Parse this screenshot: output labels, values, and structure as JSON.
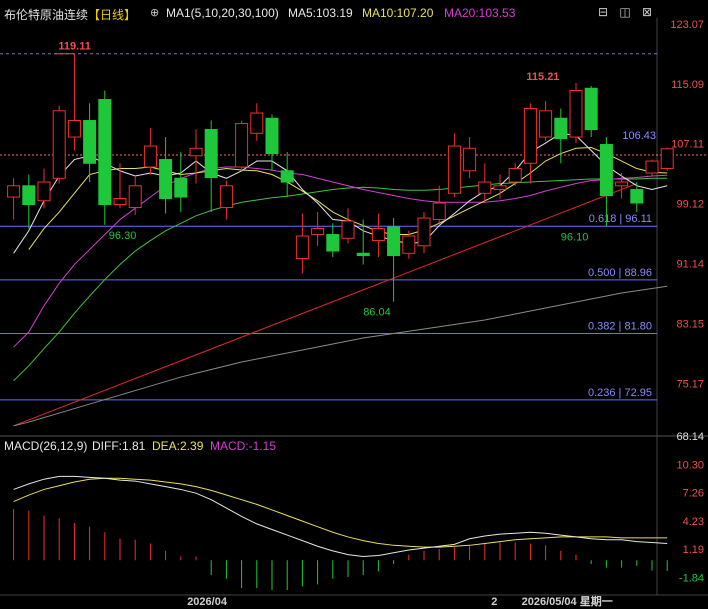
{
  "instrument": {
    "name": "布伦特原油连续",
    "period": "【日线】"
  },
  "indicators": {
    "ma_label": "MA1(5,10,20,30,100)",
    "ma5": "MA5:103.19",
    "ma10": "MA10:107.20",
    "ma20": "MA20:103.53",
    "macd_label": "MACD(26,12,9)",
    "diff": "DIFF:1.81",
    "dea": "DEA:2.39",
    "macd": "MACD:-1.15"
  },
  "toolbar": {
    "icons": [
      "settings-icon",
      "remove-icon",
      "restore-icon",
      "close-icon"
    ]
  },
  "colors": {
    "up": "#ef2f2f",
    "down": "#1fc73a",
    "ma5": "#e6e6e6",
    "ma10": "#e8e05a",
    "ma20": "#d23fd2",
    "ma30": "#3fc43f",
    "ma100": "#8a8a8a",
    "fib": "#6c6cff",
    "trend": "#e02828"
  },
  "chart_data": {
    "type": "candlestick",
    "y_axis_ticks": [
      "123.07",
      "115.09",
      "107.11",
      "99.12",
      "91.14",
      "83.15",
      "75.17",
      "68.14"
    ],
    "y_range": [
      68.14,
      123.07
    ],
    "current_price": "106.43",
    "last_close_line": 105.6,
    "high_marker": {
      "label": "119.11",
      "value": 119.11,
      "bar": 4
    },
    "high_marker2": {
      "label": "115.21",
      "value": 115.21,
      "bar": 34
    },
    "low_markers": [
      {
        "label": "96.30",
        "value": 96.3,
        "bar": 6
      },
      {
        "label": "86.04",
        "value": 86.04,
        "bar": 23
      },
      {
        "label": "96.10",
        "value": 96.1,
        "bar": 36
      }
    ],
    "fib_levels": [
      {
        "label": "0.618 | 96.11",
        "value": 96.11
      },
      {
        "label": "0.500 | 88.96",
        "value": 88.96
      },
      {
        "label": "0.382 | 81.80",
        "value": 81.8
      },
      {
        "label": "0.236 | 72.95",
        "value": 72.95
      }
    ],
    "top_ref": 119.11,
    "trendline": {
      "from": [
        0,
        69.5
      ],
      "to": [
        41,
        101.8
      ]
    },
    "candles": [
      [
        100.0,
        101.5,
        97.0,
        102.5
      ],
      [
        101.5,
        99.0,
        95.8,
        103.0
      ],
      [
        99.5,
        102.0,
        98.5,
        103.8
      ],
      [
        102.5,
        111.5,
        101.8,
        112.2
      ],
      [
        108.0,
        110.2,
        106.2,
        119.11
      ],
      [
        110.2,
        104.5,
        102.0,
        112.5
      ],
      [
        113.0,
        99.0,
        96.3,
        114.2
      ],
      [
        99.0,
        99.8,
        98.5,
        104.5
      ],
      [
        98.6,
        101.5,
        97.6,
        102.8
      ],
      [
        104.0,
        106.8,
        103.0,
        109.2
      ],
      [
        105.0,
        99.8,
        97.8,
        108.0
      ],
      [
        102.5,
        100.0,
        98.0,
        106.0
      ],
      [
        105.5,
        106.5,
        101.8,
        109.0
      ],
      [
        109.0,
        102.6,
        98.0,
        110.2
      ],
      [
        98.6,
        101.5,
        97.0,
        102.2
      ],
      [
        104.0,
        109.8,
        103.5,
        110.2
      ],
      [
        108.5,
        111.2,
        107.5,
        112.5
      ],
      [
        110.5,
        105.8,
        103.5,
        111.0
      ],
      [
        103.5,
        102.0,
        100.0,
        106.0
      ],
      [
        91.8,
        94.8,
        89.8,
        97.8
      ],
      [
        95.0,
        95.8,
        93.5,
        98.0
      ],
      [
        95.0,
        92.8,
        92.0,
        96.5
      ],
      [
        94.5,
        96.8,
        93.8,
        98.5
      ],
      [
        92.5,
        92.2,
        91.0,
        97.0
      ],
      [
        94.2,
        95.8,
        92.0,
        97.8
      ],
      [
        96.0,
        92.2,
        86.04,
        97.2
      ],
      [
        92.5,
        94.8,
        91.8,
        95.5
      ],
      [
        93.5,
        97.2,
        92.5,
        98.0
      ],
      [
        97.0,
        99.2,
        96.5,
        101.5
      ],
      [
        100.5,
        106.8,
        100.0,
        108.5
      ],
      [
        103.5,
        106.5,
        102.5,
        108.0
      ],
      [
        100.5,
        102.0,
        99.5,
        104.5
      ],
      [
        101.0,
        101.5,
        99.8,
        103.0
      ],
      [
        102.0,
        103.8,
        101.5,
        104.5
      ],
      [
        104.5,
        111.8,
        101.8,
        112.5
      ],
      [
        108.0,
        111.5,
        107.5,
        112.8
      ],
      [
        110.5,
        107.8,
        104.5,
        111.8
      ],
      [
        108.0,
        114.2,
        107.2,
        115.21
      ],
      [
        114.5,
        109.0,
        108.0,
        114.8
      ],
      [
        107.0,
        100.2,
        96.1,
        108.0
      ],
      [
        101.5,
        102.0,
        99.8,
        103.2
      ],
      [
        101.0,
        99.2,
        98.0,
        102.0
      ],
      [
        103.2,
        104.8,
        102.8,
        105.0
      ],
      [
        103.8,
        106.43,
        103.5,
        106.6
      ]
    ],
    "ma_series": {
      "ma5": [
        92.5,
        95.5,
        99.5,
        102.8,
        105.0,
        105.5,
        104.5,
        103.5,
        102.8,
        103.2,
        102.8,
        103.2,
        104.8,
        103.2,
        102.5,
        103.5,
        104.8,
        104.8,
        103.5,
        101.0,
        99.2,
        97.0,
        96.8,
        95.5,
        94.8,
        94.2,
        93.8,
        94.0,
        96.2,
        97.8,
        99.5,
        100.8,
        101.5,
        103.5,
        106.0,
        107.2,
        108.5,
        108.2,
        106.2,
        104.2,
        102.8,
        101.5,
        101.0,
        101.5
      ],
      "ma10": [
        null,
        93.0,
        95.8,
        98.0,
        100.5,
        103.0,
        103.5,
        103.8,
        103.8,
        104.0,
        103.5,
        103.0,
        103.2,
        103.5,
        103.8,
        103.6,
        103.5,
        103.0,
        102.0,
        100.8,
        99.5,
        98.0,
        97.0,
        96.2,
        95.4,
        95.0,
        95.0,
        95.6,
        96.5,
        97.5,
        98.5,
        99.5,
        100.5,
        101.8,
        103.2,
        104.8,
        105.8,
        106.5,
        106.6,
        105.8,
        104.8,
        103.8,
        103.3,
        103.2
      ],
      "ma20": [
        80.0,
        82.0,
        85.5,
        88.5,
        91.0,
        93.0,
        95.0,
        97.0,
        98.5,
        100.0,
        101.5,
        102.5,
        103.2,
        103.8,
        104.0,
        104.0,
        103.8,
        103.6,
        103.2,
        103.0,
        102.5,
        102.0,
        101.5,
        101.0,
        100.6,
        100.2,
        99.8,
        99.5,
        99.3,
        99.3,
        99.3,
        99.3,
        99.5,
        99.8,
        100.2,
        100.8,
        101.3,
        101.8,
        102.2,
        102.3,
        102.5,
        102.6,
        102.8,
        102.9
      ],
      "ma30": [
        75.5,
        77.5,
        79.8,
        82.0,
        84.5,
        86.8,
        89.0,
        91.0,
        92.8,
        94.2,
        95.5,
        96.5,
        97.5,
        98.2,
        98.8,
        99.3,
        99.6,
        99.9,
        100.1,
        100.4,
        100.7,
        101.0,
        101.2,
        101.3,
        101.2,
        101.0,
        100.9,
        100.9,
        101.0,
        101.2,
        101.4,
        101.6,
        101.8,
        101.9,
        102.0,
        102.1,
        102.2,
        102.3,
        102.4,
        102.4,
        102.4,
        102.4,
        102.5,
        102.5
      ],
      "ma100": [
        69.5,
        70.0,
        70.6,
        71.2,
        71.8,
        72.4,
        73.0,
        73.6,
        74.2,
        74.8,
        75.4,
        76.0,
        76.5,
        77.0,
        77.5,
        78.0,
        78.4,
        78.8,
        79.2,
        79.6,
        80.0,
        80.4,
        80.8,
        81.2,
        81.5,
        81.8,
        82.1,
        82.4,
        82.7,
        83.0,
        83.3,
        83.6,
        84.0,
        84.4,
        84.8,
        85.2,
        85.6,
        86.0,
        86.4,
        86.8,
        87.2,
        87.5,
        87.8,
        88.1
      ]
    },
    "macd_axis_ticks": [
      "10.30",
      "7.26",
      "4.23",
      "1.19",
      "-1.84"
    ],
    "macd_range": [
      -3.2,
      11.3
    ],
    "diff": [
      7.6,
      8.2,
      8.7,
      9.0,
      9.0,
      8.9,
      8.8,
      8.6,
      8.5,
      8.2,
      7.9,
      7.6,
      7.2,
      6.5,
      5.6,
      4.7,
      3.9,
      3.3,
      2.7,
      2.1,
      1.5,
      1.0,
      0.6,
      0.4,
      0.5,
      0.8,
      1.1,
      1.3,
      1.5,
      1.7,
      2.3,
      2.6,
      2.8,
      2.9,
      3.0,
      2.9,
      2.7,
      2.5,
      2.3,
      2.2,
      2.2,
      2.0,
      1.9,
      1.8
    ],
    "dea": [
      6.3,
      7.0,
      7.6,
      8.0,
      8.4,
      8.7,
      8.8,
      8.8,
      8.7,
      8.6,
      8.4,
      8.2,
      7.9,
      7.5,
      7.0,
      6.5,
      6.0,
      5.4,
      4.8,
      4.2,
      3.6,
      3.0,
      2.5,
      2.1,
      1.8,
      1.6,
      1.5,
      1.4,
      1.4,
      1.5,
      1.6,
      1.8,
      2.0,
      2.2,
      2.3,
      2.4,
      2.5,
      2.5,
      2.5,
      2.5,
      2.4,
      2.4,
      2.4,
      2.4
    ],
    "macd_hist": [
      5.5,
      5.3,
      4.8,
      4.5,
      4.0,
      3.6,
      3.0,
      2.3,
      2.2,
      1.8,
      1.0,
      0.4,
      0.4,
      -1.6,
      -2.0,
      -3.0,
      -3.0,
      -3.2,
      -3.2,
      -2.8,
      -2.6,
      -2.0,
      -1.8,
      -1.6,
      -1.2,
      -0.4,
      0.6,
      1.0,
      1.2,
      1.4,
      1.5,
      1.8,
      1.9,
      1.9,
      1.8,
      1.6,
      1.0,
      0.6,
      -0.4,
      -0.8,
      -0.8,
      -0.6,
      -1.1,
      -1.15
    ],
    "x_labels": [
      {
        "text": "2026/04",
        "bar": 13
      },
      {
        "text": "2",
        "bar": 33
      },
      {
        "text": "2026/05/04 星期一",
        "bar": 35
      }
    ]
  }
}
